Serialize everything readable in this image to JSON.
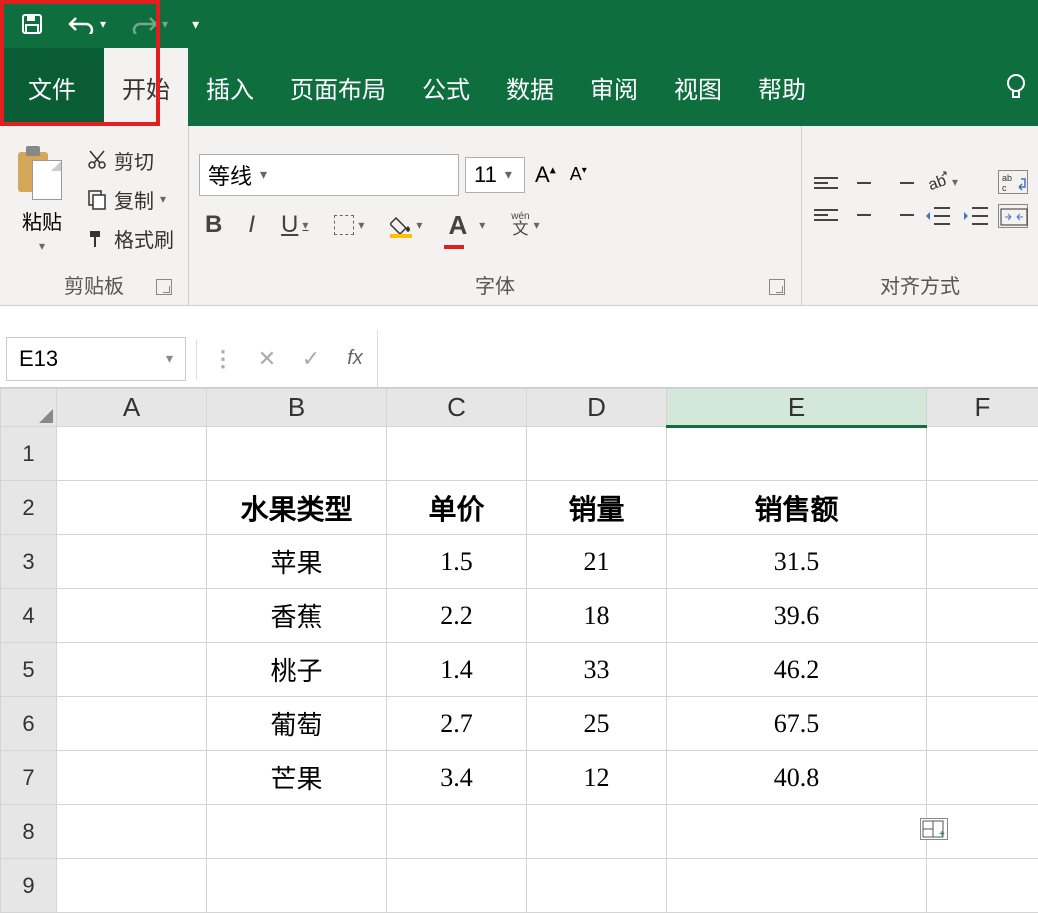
{
  "tabs": {
    "file": "文件",
    "home": "开始",
    "insert": "插入",
    "layout": "页面布局",
    "formula": "公式",
    "data": "数据",
    "review": "审阅",
    "view": "视图",
    "help": "帮助"
  },
  "ribbon": {
    "clipboard": {
      "paste": "粘贴",
      "cut": "剪切",
      "copy": "复制",
      "format_painter": "格式刷",
      "label": "剪贴板"
    },
    "font": {
      "name": "等线",
      "size": "11",
      "bold": "B",
      "italic": "I",
      "underline": "U",
      "font_color_letter": "A",
      "wen_top": "wén",
      "wen_bottom": "文",
      "label": "字体"
    },
    "align": {
      "label": "对齐方式"
    }
  },
  "name_box": "E13",
  "fx_label": "fx",
  "columns": [
    "A",
    "B",
    "C",
    "D",
    "E",
    "F"
  ],
  "row_numbers": [
    "1",
    "2",
    "3",
    "4",
    "5",
    "6",
    "7",
    "8",
    "9"
  ],
  "chart_data": {
    "type": "table",
    "headers": [
      "水果类型",
      "单价",
      "销量",
      "销售额"
    ],
    "rows": [
      [
        "苹果",
        "1.5",
        "21",
        "31.5"
      ],
      [
        "香蕉",
        "2.2",
        "18",
        "39.6"
      ],
      [
        "桃子",
        "1.4",
        "33",
        "46.2"
      ],
      [
        "葡萄",
        "2.7",
        "25",
        "67.5"
      ],
      [
        "芒果",
        "3.4",
        "12",
        "40.8"
      ]
    ]
  }
}
